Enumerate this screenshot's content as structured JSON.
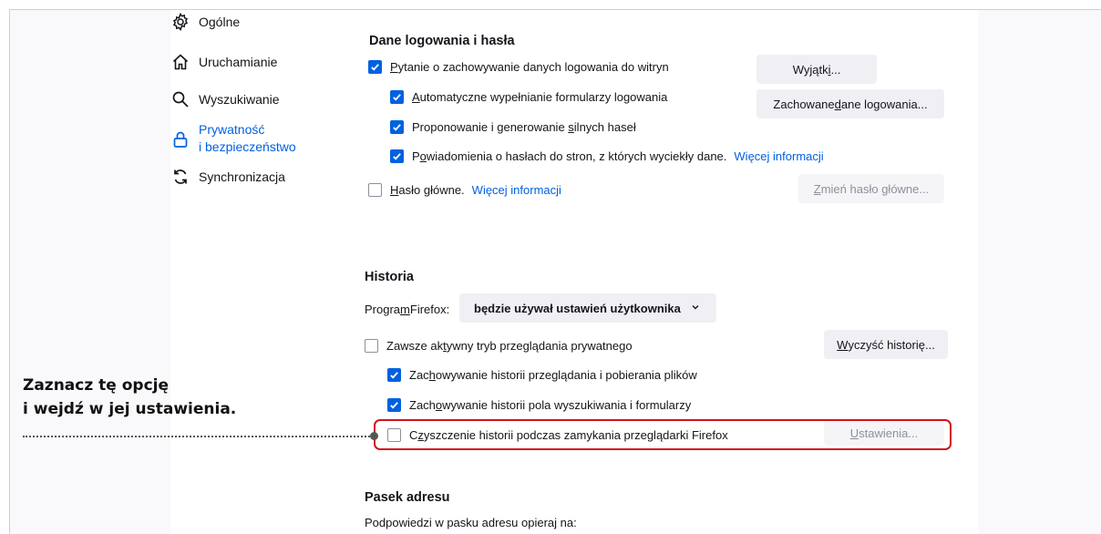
{
  "sidebar": {
    "items": [
      {
        "label": "Ogólne",
        "icon": "gear-icon"
      },
      {
        "label": "Uruchamianie",
        "icon": "home-icon"
      },
      {
        "label": "Wyszukiwanie",
        "icon": "search-icon"
      },
      {
        "label_line1": "Prywatność",
        "label_line2": "i bezpieczeństwo",
        "icon": "lock-icon",
        "active": true
      },
      {
        "label": "Synchronizacja",
        "icon": "sync-icon"
      }
    ]
  },
  "logins": {
    "heading": "Dane logowania i hasła",
    "ask_save": {
      "first": "P",
      "rest": "ytanie o zachowywanie danych logowania do witryn",
      "checked": true
    },
    "autofill": {
      "first": "A",
      "rest": "utomatyczne wypełnianie formularzy logowania",
      "checked": true
    },
    "suggest": {
      "pre": "Proponowanie i generowanie ",
      "u": "s",
      "post": "ilnych haseł",
      "checked": true
    },
    "breach": {
      "pre": "P",
      "u": "o",
      "post": "wiadomienia o hasłach do stron, z których wyciekły dane.",
      "link": "Więcej informacji",
      "checked": true
    },
    "master": {
      "u": "H",
      "post": "asło główne.",
      "link": "Więcej informacji",
      "checked": false
    },
    "exceptions_btn": {
      "pre": "Wyjątk",
      "u": "i",
      "post": "..."
    },
    "saved_btn": {
      "pre": "Zachowane ",
      "u": "d",
      "post": "ane logowania..."
    },
    "change_master_btn": {
      "u": "Z",
      "post": "mień hasło główne..."
    }
  },
  "history": {
    "heading": "Historia",
    "program_label": {
      "pre": "Progra",
      "u": "m",
      "post": " Firefox:"
    },
    "select_value": "będzie używał ustawień użytkownika",
    "private_mode": {
      "pre": "Zawsze ak",
      "u": "t",
      "post": "ywny tryb przeglądania prywatnego",
      "checked": false
    },
    "clear_btn": {
      "u": "W",
      "post": "yczyść historię..."
    },
    "browsing": {
      "pre": "Zac",
      "u": "h",
      "post": "owywanie historii przeglądania i pobierania plików",
      "checked": true
    },
    "forms": {
      "pre": "Zach",
      "u": "o",
      "post": "wywanie historii pola wyszukiwania i formularzy",
      "checked": true
    },
    "clear_on_close": {
      "pre": "C",
      "u": "z",
      "post": "yszczenie historii podczas zamykania przeglądarki Firefox",
      "checked": false
    },
    "settings_btn": {
      "u": "U",
      "post": "stawienia..."
    }
  },
  "address_bar": {
    "heading": "Pasek adresu",
    "subtext": "Podpowiedzi w pasku adresu opieraj na:"
  },
  "callout": {
    "line1": "Zaznacz tę opcję",
    "line2": "i wejdź w jej ustawienia."
  },
  "colors": {
    "accent": "#0061e0",
    "highlight": "#d0131d"
  }
}
